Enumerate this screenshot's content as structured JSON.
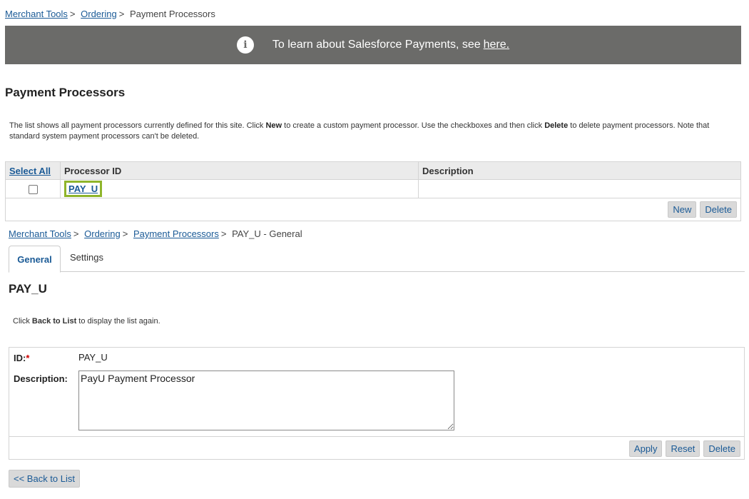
{
  "breadcrumb_top": {
    "items": [
      "Merchant Tools",
      "Ordering"
    ],
    "current": "Payment Processors",
    "separator": ">"
  },
  "banner": {
    "icon": "info-icon",
    "text": "To learn about Salesforce Payments, see",
    "link": "here."
  },
  "list": {
    "title": "Payment Processors",
    "description_parts": [
      "The list shows all payment processors currently defined for this site. Click ",
      "New",
      " to create a custom payment processor. Use the checkboxes and then click ",
      "Delete",
      " to delete payment processors. Note that standard system payment processors can't be deleted."
    ],
    "columns": [
      "Select All",
      "Processor ID",
      "Description"
    ],
    "rows": [
      {
        "processor_id": "PAY_U",
        "description": ""
      }
    ],
    "new_label": "New",
    "delete_label": "Delete"
  },
  "breadcrumb_detail": {
    "items": [
      "Merchant Tools",
      "Ordering",
      "Payment Processors"
    ],
    "current": "PAY_U - General",
    "separator": ">"
  },
  "tabs": [
    {
      "label": "General",
      "active": true
    },
    {
      "label": "Settings",
      "active": false
    }
  ],
  "detail": {
    "title": "PAY_U",
    "hint_parts": [
      "Click ",
      "Back to List",
      " to display the list again."
    ],
    "id_label": "ID:",
    "required_mark": "*",
    "id_value": "PAY_U",
    "description_label": "Description:",
    "description_value": "PayU Payment Processor",
    "apply_label": "Apply",
    "reset_label": "Reset",
    "delete_label": "Delete",
    "back_label": "<< Back to List"
  },
  "colors": {
    "banner_bg": "#6b6b69",
    "link": "#1a5a96",
    "highlight_border": "#8fb52b",
    "button_bg": "#d9d9d9",
    "table_header_bg": "#ebebeb",
    "required": "#cc0000"
  }
}
